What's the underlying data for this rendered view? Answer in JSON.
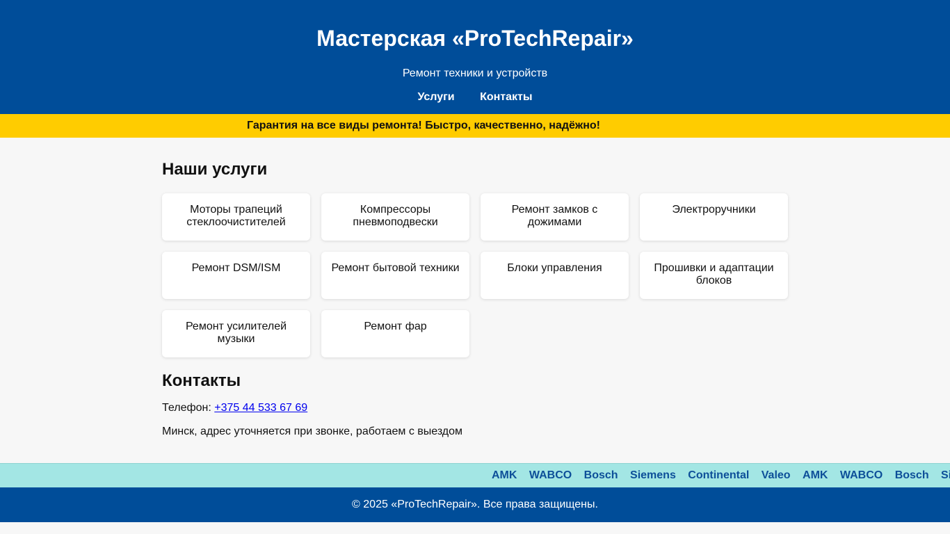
{
  "header": {
    "title": "Мастерская «ProTechRepair»",
    "subtitle": "Ремонт техники и устройств",
    "nav": [
      {
        "label": "Услуги"
      },
      {
        "label": "Контакты"
      }
    ]
  },
  "banner": {
    "text": "Гарантия на все виды ремонта! Быстро, качественно, надёжно!"
  },
  "services": {
    "heading": "Наши услуги",
    "items": [
      "Моторы трапеций стеклоочистителей",
      "Компрессоры пневмоподвески",
      "Ремонт замков с дожимами",
      "Электроручники",
      "Ремонт DSM/ISM",
      "Ремонт бытовой техники",
      "Блоки управления",
      "Прошивки и адаптации блоков",
      "Ремонт усилителей музыки",
      "Ремонт фар"
    ]
  },
  "contacts": {
    "heading": "Контакты",
    "phone_label": "Телефон: ",
    "phone": "+375 44 533 67 69",
    "address": "Минск, адрес уточняется при звонке, работаем с выездом"
  },
  "brands": [
    "AMK",
    "WABCO",
    "Bosch",
    "Siemens",
    "Continental",
    "Valeo",
    "AMK",
    "WABCO",
    "Bosch",
    "Siemens"
  ],
  "footer": {
    "text": "© 2025 «ProTechRepair». Все права защищены."
  },
  "colors": {
    "header_bg": "#004d99",
    "banner_bg": "#ffcc00",
    "brands_bg": "#a3e6e4",
    "link": "#0000ee"
  }
}
